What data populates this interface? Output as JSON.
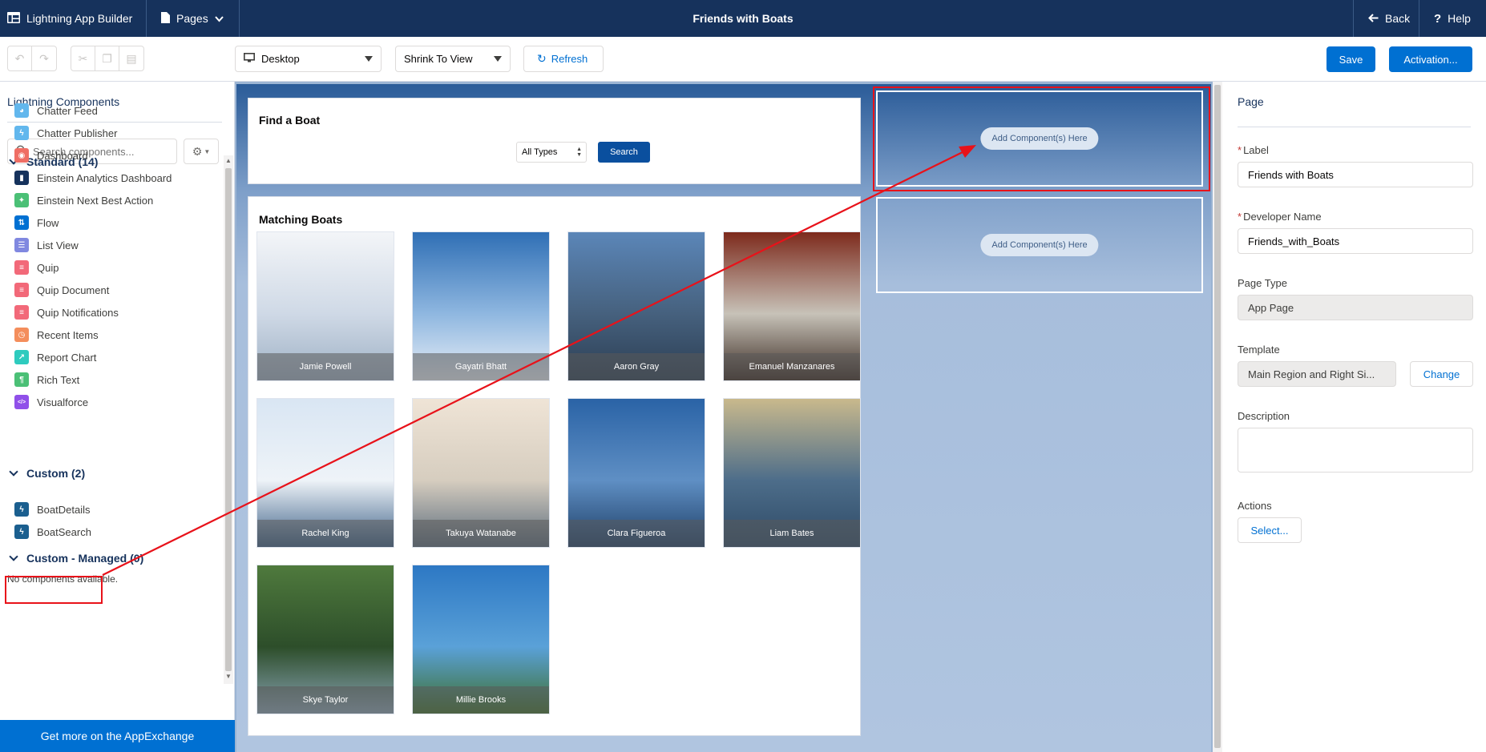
{
  "topbar": {
    "app_name": "Lightning App Builder",
    "pages_label": "Pages",
    "page_title": "Friends with Boats",
    "back_label": "Back",
    "help_label": "Help"
  },
  "toolbar": {
    "device_value": "Desktop",
    "view_value": "Shrink To View",
    "refresh_label": "Refresh",
    "save_label": "Save",
    "activation_label": "Activation..."
  },
  "left_panel": {
    "title": "Lightning Components",
    "search_placeholder": "Search components...",
    "standard": {
      "header": "Standard (14)",
      "items": [
        {
          "label": "Chatter Feed",
          "icon": "chatter-feed-icon",
          "color": "#62b7ed"
        },
        {
          "label": "Chatter Publisher",
          "icon": "lightning-bolt-icon",
          "color": "#62b7ed"
        },
        {
          "label": "Dashboard",
          "icon": "dashboard-icon",
          "color": "#ef6e64"
        },
        {
          "label": "Einstein Analytics Dashboard",
          "icon": "analytics-bars-icon",
          "color": "#16325c"
        },
        {
          "label": "Einstein Next Best Action",
          "icon": "next-best-action-icon",
          "color": "#4bc076"
        },
        {
          "label": "Flow",
          "icon": "flow-icon",
          "color": "#0070d2"
        },
        {
          "label": "List View",
          "icon": "list-view-icon",
          "color": "#8088e0"
        },
        {
          "label": "Quip",
          "icon": "quip-icon",
          "color": "#f26979"
        },
        {
          "label": "Quip Document",
          "icon": "quip-icon",
          "color": "#f26979"
        },
        {
          "label": "Quip Notifications",
          "icon": "quip-icon",
          "color": "#f26979"
        },
        {
          "label": "Recent Items",
          "icon": "clock-icon",
          "color": "#f48e5c"
        },
        {
          "label": "Report Chart",
          "icon": "report-chart-icon",
          "color": "#2ecbbe"
        },
        {
          "label": "Rich Text",
          "icon": "rich-text-icon",
          "color": "#4bc076"
        },
        {
          "label": "Visualforce",
          "icon": "code-icon",
          "color": "#9050e9"
        }
      ]
    },
    "custom": {
      "header": "Custom (2)",
      "items": [
        {
          "label": "BoatDetails",
          "icon": "lightning-bolt-icon",
          "color": "#1b5f8f"
        },
        {
          "label": "BoatSearch",
          "icon": "lightning-bolt-icon",
          "color": "#1b5f8f"
        }
      ]
    },
    "managed": {
      "header": "Custom - Managed (0)",
      "empty_text": "No components available."
    },
    "appexchange_label": "Get more on the AppExchange"
  },
  "canvas": {
    "find_card": {
      "title": "Find a Boat",
      "type_select": "All Types",
      "search_label": "Search"
    },
    "matching_card": {
      "title": "Matching Boats",
      "boats": [
        {
          "owner": "Jamie Powell"
        },
        {
          "owner": "Gayatri Bhatt"
        },
        {
          "owner": "Aaron Gray"
        },
        {
          "owner": "Emanuel Manzanares"
        },
        {
          "owner": "Rachel King"
        },
        {
          "owner": "Takuya Watanabe"
        },
        {
          "owner": "Clara Figueroa"
        },
        {
          "owner": "Liam Bates"
        },
        {
          "owner": "Skye Taylor"
        },
        {
          "owner": "Millie Brooks"
        }
      ]
    },
    "right_regions": {
      "top_add_label": "Add Component(s) Here",
      "bottom_add_label": "Add Component(s) Here"
    }
  },
  "right_panel": {
    "title": "Page",
    "label_field": {
      "label": "Label",
      "value": "Friends with Boats"
    },
    "dev_name_field": {
      "label": "Developer Name",
      "value": "Friends_with_Boats"
    },
    "page_type_field": {
      "label": "Page Type",
      "value": "App Page"
    },
    "template_field": {
      "label": "Template",
      "value": "Main Region and Right Si...",
      "change_label": "Change"
    },
    "description_label": "Description",
    "actions": {
      "label": "Actions",
      "select_label": "Select..."
    }
  },
  "colors": {
    "header_bg": "#16325c",
    "brand": "#0070d2",
    "annotation": "#e8121a"
  }
}
